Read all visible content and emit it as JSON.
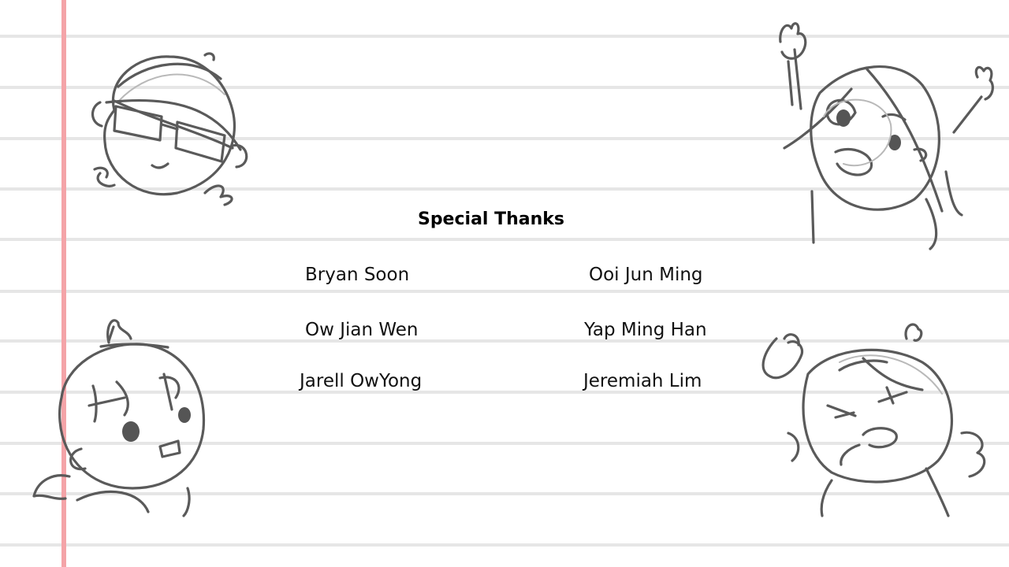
{
  "slide": {
    "title": "Special Thanks",
    "names": {
      "col1": [
        "Bryan Soon",
        "Ow Jian Wen",
        "Jarell OwYong"
      ],
      "col2": [
        "Ooi Jun Ming",
        "Yap Ming Han",
        "Jeremiah Lim"
      ]
    }
  },
  "style": {
    "margin_line_color": "#f4a4a8",
    "rule_color": "#e6e6e6",
    "sketch_color": "#5a5a5a"
  },
  "icons": [
    "glasses-boy-sketch",
    "waving-girl-sketch",
    "surprised-boy-sketch",
    "angry-girl-sketch"
  ]
}
